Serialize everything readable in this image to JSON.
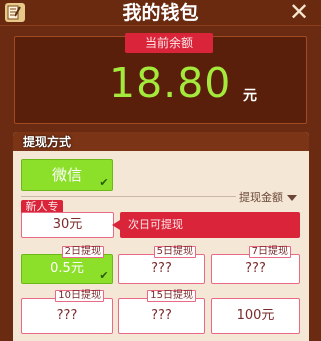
{
  "header": {
    "title": "我的钱包",
    "close_glyph": "✕",
    "edit_icon": "edit-icon"
  },
  "balance": {
    "tag": "当前余额",
    "amount": "18.80",
    "unit": "元"
  },
  "withdraw": {
    "section_title": "提现方式",
    "method_label": "微信",
    "amount_label": "提现金额",
    "newbie_tag": "新人专享",
    "tooltip": "次日可提现",
    "options": [
      {
        "value": "30元",
        "tag": ""
      },
      {
        "value": "0.5元",
        "tag": "2日提现"
      },
      {
        "value": "???",
        "tag": "5日提现"
      },
      {
        "value": "???",
        "tag": "7日提现"
      },
      {
        "value": "???",
        "tag": "10日提现"
      },
      {
        "value": "???",
        "tag": "15日提现"
      },
      {
        "value": "100元",
        "tag": ""
      }
    ]
  },
  "colors": {
    "background": "#6b2a12",
    "accent_red": "#d9243a",
    "accent_green": "#8ce02a",
    "balance_text": "#a3ea3c"
  }
}
